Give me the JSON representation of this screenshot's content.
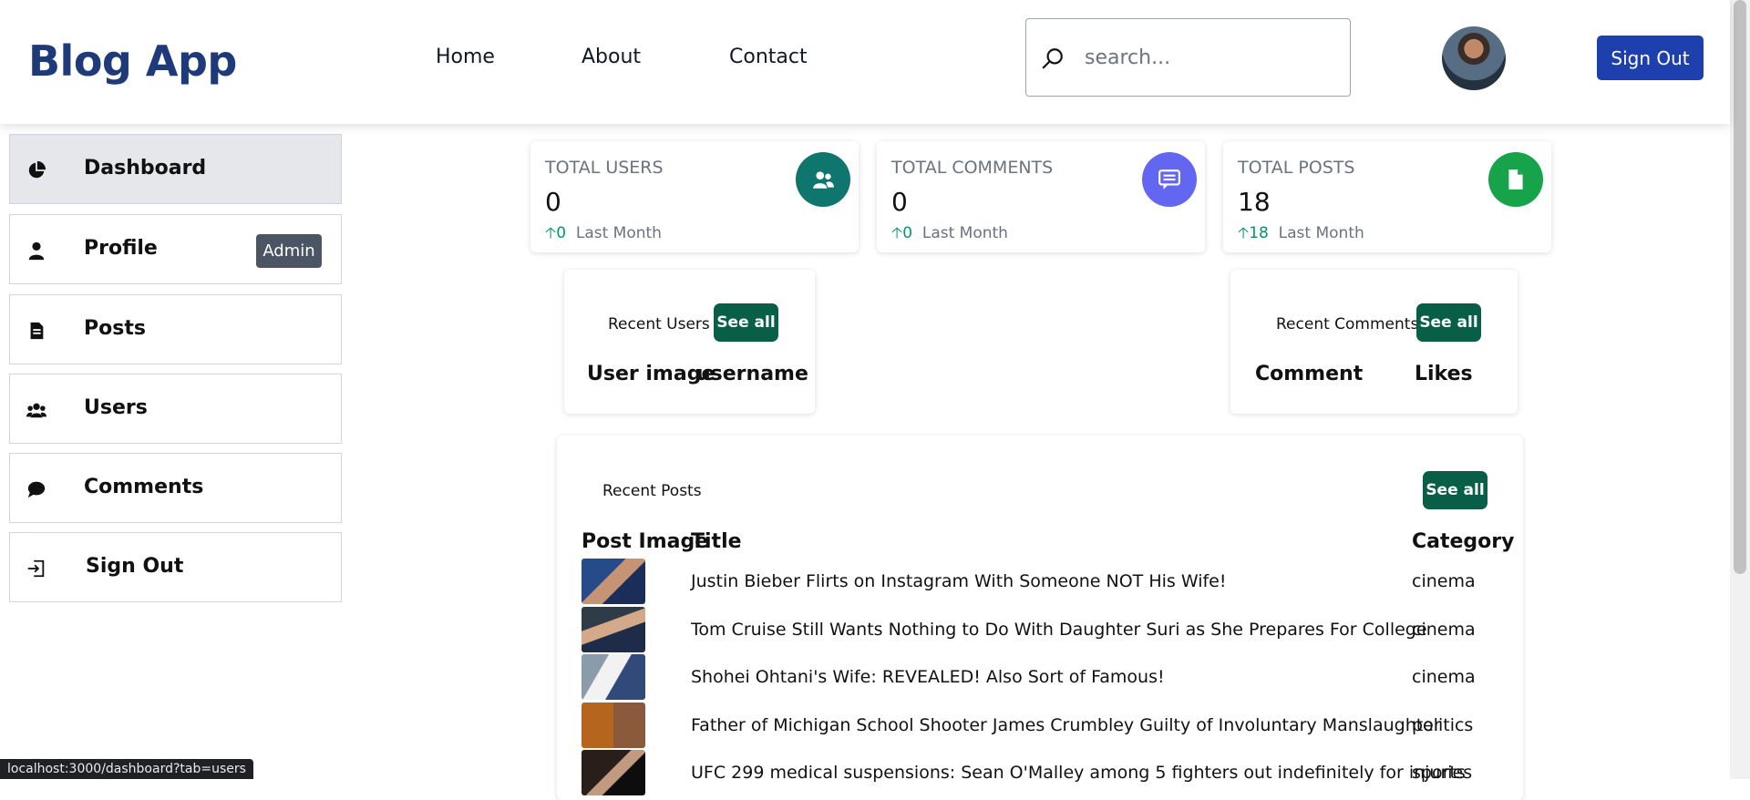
{
  "header": {
    "brand": "Blog App",
    "nav": [
      "Home",
      "About",
      "Contact"
    ],
    "search_placeholder": "search...",
    "signout_label": "Sign Out"
  },
  "sidebar": {
    "items": [
      {
        "label": "Dashboard",
        "icon": "pie-chart-icon",
        "active": true
      },
      {
        "label": "Profile",
        "icon": "user-icon",
        "badge": "Admin"
      },
      {
        "label": "Posts",
        "icon": "document-icon"
      },
      {
        "label": "Users",
        "icon": "users-icon"
      },
      {
        "label": "Comments",
        "icon": "comment-icon"
      },
      {
        "label": "Sign Out",
        "icon": "sign-out-icon"
      }
    ]
  },
  "stats": [
    {
      "title": "TOTAL USERS",
      "value": "0",
      "change": "0",
      "period": "Last Month",
      "icon": "users-icon",
      "color": "#0f766e"
    },
    {
      "title": "TOTAL COMMENTS",
      "value": "0",
      "change": "0",
      "period": "Last Month",
      "icon": "comment-icon",
      "color": "#6366f1"
    },
    {
      "title": "TOTAL POSTS",
      "value": "18",
      "change": "18",
      "period": "Last Month",
      "icon": "document-icon",
      "color": "#16a34a"
    }
  ],
  "recent_users": {
    "title": "Recent Users",
    "see_all": "See all",
    "columns": [
      "User image",
      "username"
    ]
  },
  "recent_comments": {
    "title": "Recent Comments",
    "see_all": "See all",
    "columns": [
      "Comment",
      "Likes"
    ]
  },
  "recent_posts": {
    "title": "Recent Posts",
    "see_all": "See all",
    "columns": [
      "Post Image",
      "Title",
      "Category"
    ],
    "rows": [
      {
        "title": "Justin Bieber Flirts on Instagram With Someone NOT His Wife!",
        "category": "cinema"
      },
      {
        "title": "Tom Cruise Still Wants Nothing to Do With Daughter Suri as She Prepares For College",
        "category": "cinema"
      },
      {
        "title": "Shohei Ohtani's Wife: REVEALED! Also Sort of Famous!",
        "category": "cinema"
      },
      {
        "title": "Father of Michigan School Shooter James Crumbley Guilty of Involuntary Manslaughter",
        "category": "politics"
      },
      {
        "title": "UFC 299 medical suspensions: Sean O'Malley among 5 fighters out indefinitely for injuries",
        "category": "sports"
      }
    ]
  },
  "status_url": "localhost:3000/dashboard?tab=users"
}
